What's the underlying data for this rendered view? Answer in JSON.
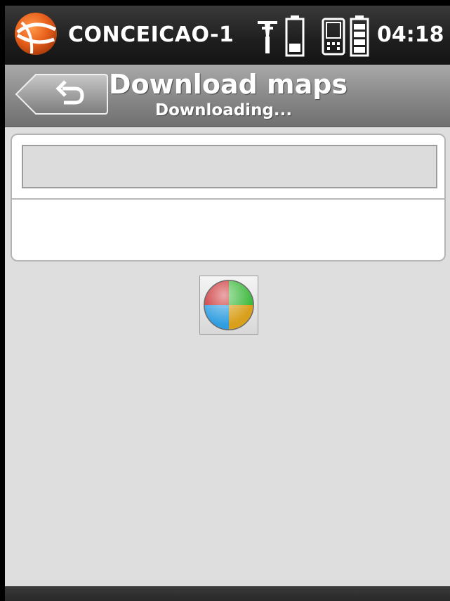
{
  "status_bar": {
    "device_name": "CONCEICAO-1",
    "time": "04:18",
    "icons": [
      "app-logo-icon",
      "gps-antenna-icon",
      "receiver-battery-icon",
      "controller-icon",
      "controller-battery-icon"
    ]
  },
  "header": {
    "back_label": "back",
    "title": "Download maps",
    "subtitle": "Downloading..."
  },
  "download_panel": {
    "progress": 0,
    "status_text": ""
  },
  "busy_indicator": {
    "icon": "busy-wait-icon"
  },
  "colors": {
    "background": "#dedede",
    "header_gradient_top": "#a9a9a9",
    "status_bar": "#1e1e1e",
    "logo_orange": "#e8601c"
  }
}
